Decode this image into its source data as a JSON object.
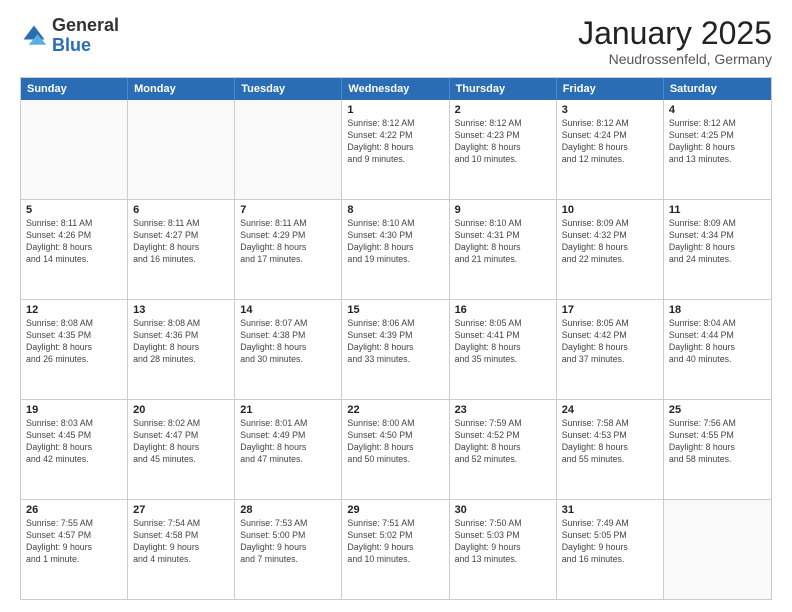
{
  "header": {
    "logo_general": "General",
    "logo_blue": "Blue",
    "month_title": "January 2025",
    "location": "Neudrossenfeld, Germany"
  },
  "weekdays": [
    "Sunday",
    "Monday",
    "Tuesday",
    "Wednesday",
    "Thursday",
    "Friday",
    "Saturday"
  ],
  "rows": [
    [
      {
        "day": "",
        "info": "",
        "empty": true
      },
      {
        "day": "",
        "info": "",
        "empty": true
      },
      {
        "day": "",
        "info": "",
        "empty": true
      },
      {
        "day": "1",
        "info": "Sunrise: 8:12 AM\nSunset: 4:22 PM\nDaylight: 8 hours\nand 9 minutes.",
        "empty": false
      },
      {
        "day": "2",
        "info": "Sunrise: 8:12 AM\nSunset: 4:23 PM\nDaylight: 8 hours\nand 10 minutes.",
        "empty": false
      },
      {
        "day": "3",
        "info": "Sunrise: 8:12 AM\nSunset: 4:24 PM\nDaylight: 8 hours\nand 12 minutes.",
        "empty": false
      },
      {
        "day": "4",
        "info": "Sunrise: 8:12 AM\nSunset: 4:25 PM\nDaylight: 8 hours\nand 13 minutes.",
        "empty": false
      }
    ],
    [
      {
        "day": "5",
        "info": "Sunrise: 8:11 AM\nSunset: 4:26 PM\nDaylight: 8 hours\nand 14 minutes.",
        "empty": false
      },
      {
        "day": "6",
        "info": "Sunrise: 8:11 AM\nSunset: 4:27 PM\nDaylight: 8 hours\nand 16 minutes.",
        "empty": false
      },
      {
        "day": "7",
        "info": "Sunrise: 8:11 AM\nSunset: 4:29 PM\nDaylight: 8 hours\nand 17 minutes.",
        "empty": false
      },
      {
        "day": "8",
        "info": "Sunrise: 8:10 AM\nSunset: 4:30 PM\nDaylight: 8 hours\nand 19 minutes.",
        "empty": false
      },
      {
        "day": "9",
        "info": "Sunrise: 8:10 AM\nSunset: 4:31 PM\nDaylight: 8 hours\nand 21 minutes.",
        "empty": false
      },
      {
        "day": "10",
        "info": "Sunrise: 8:09 AM\nSunset: 4:32 PM\nDaylight: 8 hours\nand 22 minutes.",
        "empty": false
      },
      {
        "day": "11",
        "info": "Sunrise: 8:09 AM\nSunset: 4:34 PM\nDaylight: 8 hours\nand 24 minutes.",
        "empty": false
      }
    ],
    [
      {
        "day": "12",
        "info": "Sunrise: 8:08 AM\nSunset: 4:35 PM\nDaylight: 8 hours\nand 26 minutes.",
        "empty": false
      },
      {
        "day": "13",
        "info": "Sunrise: 8:08 AM\nSunset: 4:36 PM\nDaylight: 8 hours\nand 28 minutes.",
        "empty": false
      },
      {
        "day": "14",
        "info": "Sunrise: 8:07 AM\nSunset: 4:38 PM\nDaylight: 8 hours\nand 30 minutes.",
        "empty": false
      },
      {
        "day": "15",
        "info": "Sunrise: 8:06 AM\nSunset: 4:39 PM\nDaylight: 8 hours\nand 33 minutes.",
        "empty": false
      },
      {
        "day": "16",
        "info": "Sunrise: 8:05 AM\nSunset: 4:41 PM\nDaylight: 8 hours\nand 35 minutes.",
        "empty": false
      },
      {
        "day": "17",
        "info": "Sunrise: 8:05 AM\nSunset: 4:42 PM\nDaylight: 8 hours\nand 37 minutes.",
        "empty": false
      },
      {
        "day": "18",
        "info": "Sunrise: 8:04 AM\nSunset: 4:44 PM\nDaylight: 8 hours\nand 40 minutes.",
        "empty": false
      }
    ],
    [
      {
        "day": "19",
        "info": "Sunrise: 8:03 AM\nSunset: 4:45 PM\nDaylight: 8 hours\nand 42 minutes.",
        "empty": false
      },
      {
        "day": "20",
        "info": "Sunrise: 8:02 AM\nSunset: 4:47 PM\nDaylight: 8 hours\nand 45 minutes.",
        "empty": false
      },
      {
        "day": "21",
        "info": "Sunrise: 8:01 AM\nSunset: 4:49 PM\nDaylight: 8 hours\nand 47 minutes.",
        "empty": false
      },
      {
        "day": "22",
        "info": "Sunrise: 8:00 AM\nSunset: 4:50 PM\nDaylight: 8 hours\nand 50 minutes.",
        "empty": false
      },
      {
        "day": "23",
        "info": "Sunrise: 7:59 AM\nSunset: 4:52 PM\nDaylight: 8 hours\nand 52 minutes.",
        "empty": false
      },
      {
        "day": "24",
        "info": "Sunrise: 7:58 AM\nSunset: 4:53 PM\nDaylight: 8 hours\nand 55 minutes.",
        "empty": false
      },
      {
        "day": "25",
        "info": "Sunrise: 7:56 AM\nSunset: 4:55 PM\nDaylight: 8 hours\nand 58 minutes.",
        "empty": false
      }
    ],
    [
      {
        "day": "26",
        "info": "Sunrise: 7:55 AM\nSunset: 4:57 PM\nDaylight: 9 hours\nand 1 minute.",
        "empty": false
      },
      {
        "day": "27",
        "info": "Sunrise: 7:54 AM\nSunset: 4:58 PM\nDaylight: 9 hours\nand 4 minutes.",
        "empty": false
      },
      {
        "day": "28",
        "info": "Sunrise: 7:53 AM\nSunset: 5:00 PM\nDaylight: 9 hours\nand 7 minutes.",
        "empty": false
      },
      {
        "day": "29",
        "info": "Sunrise: 7:51 AM\nSunset: 5:02 PM\nDaylight: 9 hours\nand 10 minutes.",
        "empty": false
      },
      {
        "day": "30",
        "info": "Sunrise: 7:50 AM\nSunset: 5:03 PM\nDaylight: 9 hours\nand 13 minutes.",
        "empty": false
      },
      {
        "day": "31",
        "info": "Sunrise: 7:49 AM\nSunset: 5:05 PM\nDaylight: 9 hours\nand 16 minutes.",
        "empty": false
      },
      {
        "day": "",
        "info": "",
        "empty": true
      }
    ]
  ]
}
